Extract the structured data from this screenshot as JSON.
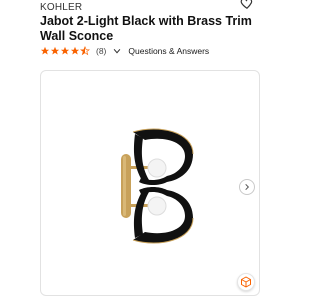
{
  "product": {
    "brand": "KOHLER",
    "title": "Jabot 2-Light Black with Brass Trim Wall Sconce"
  },
  "rating": {
    "value": 4.5,
    "max": 5,
    "count_label": "(8)",
    "qa_label": "Questions & Answers"
  },
  "icons": {
    "favorite": "heart-outline-icon",
    "expand": "chevron-down-icon",
    "next": "chevron-right-icon",
    "ar_view": "cube-icon"
  },
  "colors": {
    "star": "#f96302",
    "ar_accent": "#f96302",
    "fixture_black": "#111111",
    "brass": "#c8a15a"
  }
}
